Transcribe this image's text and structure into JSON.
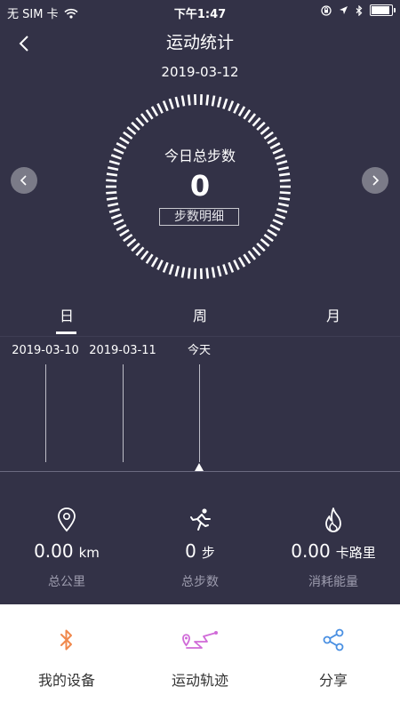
{
  "status_bar": {
    "carrier": "无 SIM 卡",
    "time": "下午1:47"
  },
  "header": {
    "title": "运动统计",
    "date": "2019-03-12"
  },
  "ring": {
    "label": "今日总步数",
    "value": "0",
    "detail_button": "步数明细"
  },
  "tabs": [
    {
      "label": "日",
      "active": true
    },
    {
      "label": "周",
      "active": false
    },
    {
      "label": "月",
      "active": false
    }
  ],
  "timeline": {
    "labels": [
      "2019-03-10",
      "2019-03-11",
      "今天"
    ]
  },
  "stats": [
    {
      "value": "0.00",
      "unit": "km",
      "label": "总公里",
      "icon": "location-pin-icon"
    },
    {
      "value": "0",
      "unit": "步",
      "label": "总步数",
      "icon": "running-person-icon"
    },
    {
      "value": "0.00",
      "unit": "卡路里",
      "label": "消耗能量",
      "icon": "flame-icon"
    }
  ],
  "bottom_nav": [
    {
      "label": "我的设备",
      "icon": "bluetooth-icon",
      "color": "#f0884c"
    },
    {
      "label": "运动轨迹",
      "icon": "route-icon",
      "color": "#d06ad8"
    },
    {
      "label": "分享",
      "icon": "share-icon",
      "color": "#4a90e2"
    }
  ],
  "colors": {
    "background": "#333247",
    "bottom_background": "#ffffff"
  }
}
